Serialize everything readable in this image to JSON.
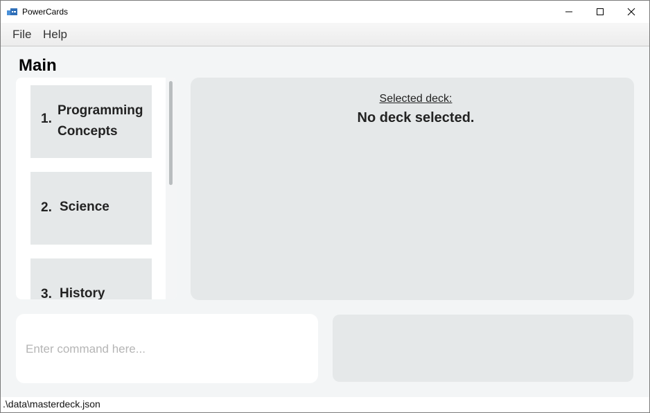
{
  "window": {
    "title": "PowerCards",
    "controls": [
      "minimize-icon",
      "maximize-icon",
      "close-icon"
    ]
  },
  "menu": {
    "items": [
      "File",
      "Help"
    ]
  },
  "main": {
    "title": "Main",
    "decks": [
      {
        "index": "1.",
        "name": "Programming Concepts"
      },
      {
        "index": "2.",
        "name": "Science"
      },
      {
        "index": "3.",
        "name": "History"
      }
    ],
    "selected_label": "Selected deck:",
    "selected_value": "No deck selected."
  },
  "command": {
    "placeholder": "Enter command here...",
    "value": ""
  },
  "result": {
    "text": ""
  },
  "status": {
    "path": ".\\data\\masterdeck.json"
  },
  "colors": {
    "background": "#f3f5f6",
    "card": "#e5e8e9",
    "panel_white": "#ffffff"
  }
}
